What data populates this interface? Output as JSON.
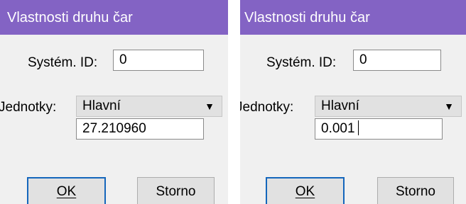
{
  "colors": {
    "titlebar": "#8363c4",
    "dialog_bg": "#f0f0f0",
    "default_button_border": "#1466bc"
  },
  "dialogs": [
    {
      "title": "Vlastnosti druhu čar",
      "system_id_label": "Systém. ID:",
      "system_id_value": "0",
      "units_label": "Jednotky:",
      "units_selected": "Hlavní",
      "scale_value": "27.210960",
      "ok_label": "OK",
      "cancel_label": "Storno"
    },
    {
      "title": "Vlastnosti druhu čar",
      "system_id_label": "Systém. ID:",
      "system_id_value": "0",
      "units_label": "Jednotky:",
      "units_selected": "Hlavní",
      "scale_value": "0.001",
      "ok_label": "OK",
      "cancel_label": "Storno"
    }
  ]
}
